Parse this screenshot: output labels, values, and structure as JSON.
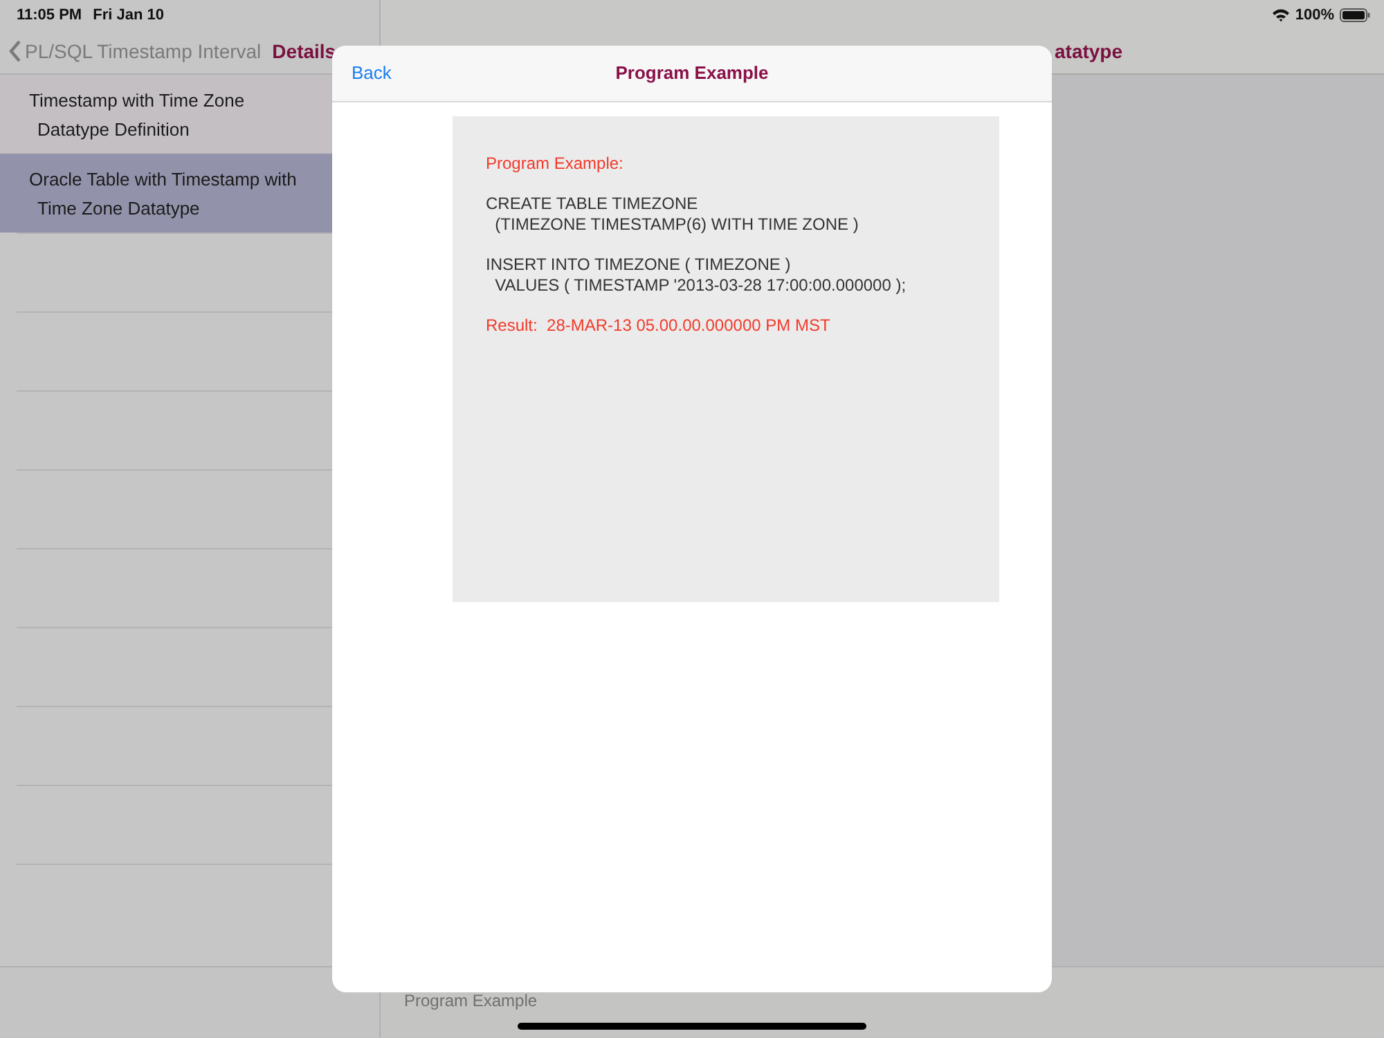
{
  "status_bar": {
    "time": "11:05 PM",
    "date": "Fri Jan 10",
    "battery": "100%"
  },
  "sidebar": {
    "back_label": "PL/SQL Timestamp Interval",
    "title": "Details",
    "items": [
      {
        "lines": [
          "Timestamp with Time Zone",
          "Datatype Definition"
        ],
        "selected": false
      },
      {
        "lines": [
          "Oracle Table with Timestamp with",
          "Time Zone Datatype"
        ],
        "selected": true
      }
    ]
  },
  "detail": {
    "title": "atatype",
    "footer": "Program Example"
  },
  "modal": {
    "back_label": "Back",
    "title": "Program Example",
    "blocks": [
      {
        "kind": "note",
        "lines": [
          "Program Example:"
        ]
      },
      {
        "kind": "code",
        "lines": [
          "CREATE TABLE TIMEZONE",
          "  (TIMEZONE TIMESTAMP(6) WITH TIME ZONE )"
        ]
      },
      {
        "kind": "code",
        "lines": [
          "INSERT INTO TIMEZONE ( TIMEZONE )",
          "  VALUES ( TIMESTAMP '2013-03-28 17:00:00.000000 );"
        ]
      },
      {
        "kind": "note",
        "lines": [
          "Result:  28-MAR-13 05.00.00.000000 PM MST"
        ]
      }
    ]
  }
}
